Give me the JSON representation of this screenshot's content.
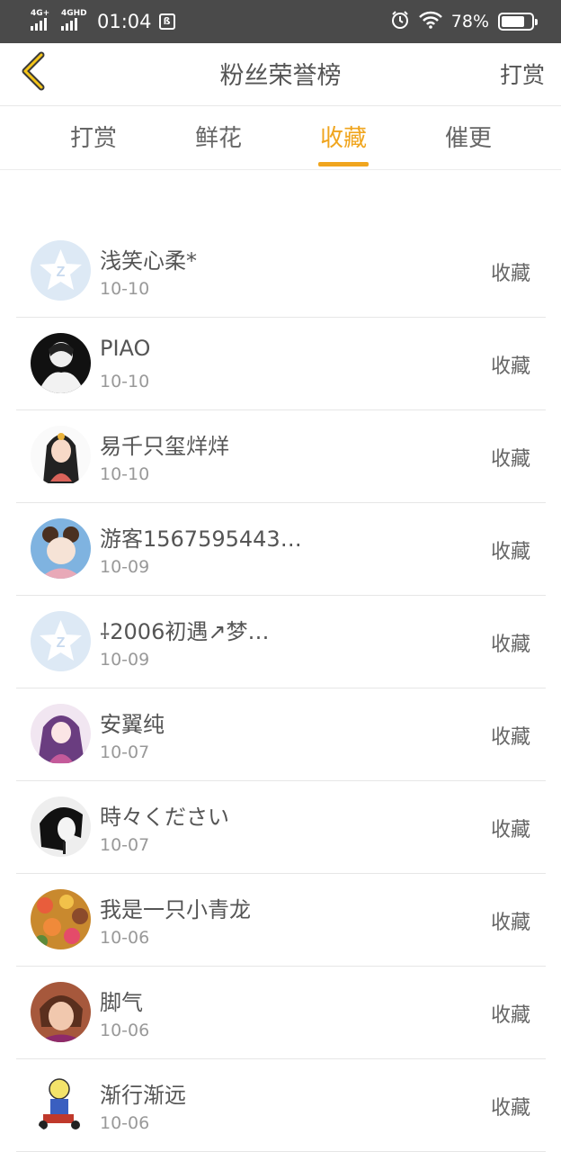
{
  "status_bar": {
    "net1": "4G+",
    "net2": "4GHD",
    "time": "01:04",
    "box_icon_char": "ß",
    "battery_percent_text": "78%",
    "battery_level": 0.78
  },
  "nav": {
    "back_icon": "chevron-left-icon",
    "title": "粉丝荣誉榜",
    "right_action": "打赏"
  },
  "tabs": [
    {
      "label": "打赏",
      "active": false
    },
    {
      "label": "鲜花",
      "active": false
    },
    {
      "label": "收藏",
      "active": true
    },
    {
      "label": "催更",
      "active": false
    }
  ],
  "accent_color": "#f0a51e",
  "fans": [
    {
      "name": "浅笑心柔*",
      "date": "10-10",
      "action": "收藏",
      "avatar": "default-star"
    },
    {
      "name": "PIAO",
      "date": "10-10",
      "action": "收藏",
      "avatar": "dark-photo"
    },
    {
      "name": "易千只玺烊烊",
      "date": "10-10",
      "action": "收藏",
      "avatar": "girl-drawing"
    },
    {
      "name": "游客1567595443…",
      "date": "10-09",
      "action": "收藏",
      "avatar": "cartoon-girl"
    },
    {
      "name": "⸸2006初遇↗梦…",
      "date": "10-09",
      "action": "收藏",
      "avatar": "default-star"
    },
    {
      "name": "安翼纯",
      "date": "10-07",
      "action": "收藏",
      "avatar": "anime-purple"
    },
    {
      "name": "時々ください",
      "date": "10-07",
      "action": "收藏",
      "avatar": "bw-sketch"
    },
    {
      "name": "我是一只小青龙",
      "date": "10-06",
      "action": "收藏",
      "avatar": "food-photo"
    },
    {
      "name": "脚气",
      "date": "10-06",
      "action": "收藏",
      "avatar": "portrait-photo"
    },
    {
      "name": "渐行渐远",
      "date": "10-06",
      "action": "收藏",
      "avatar": "cartoon-figure"
    }
  ]
}
